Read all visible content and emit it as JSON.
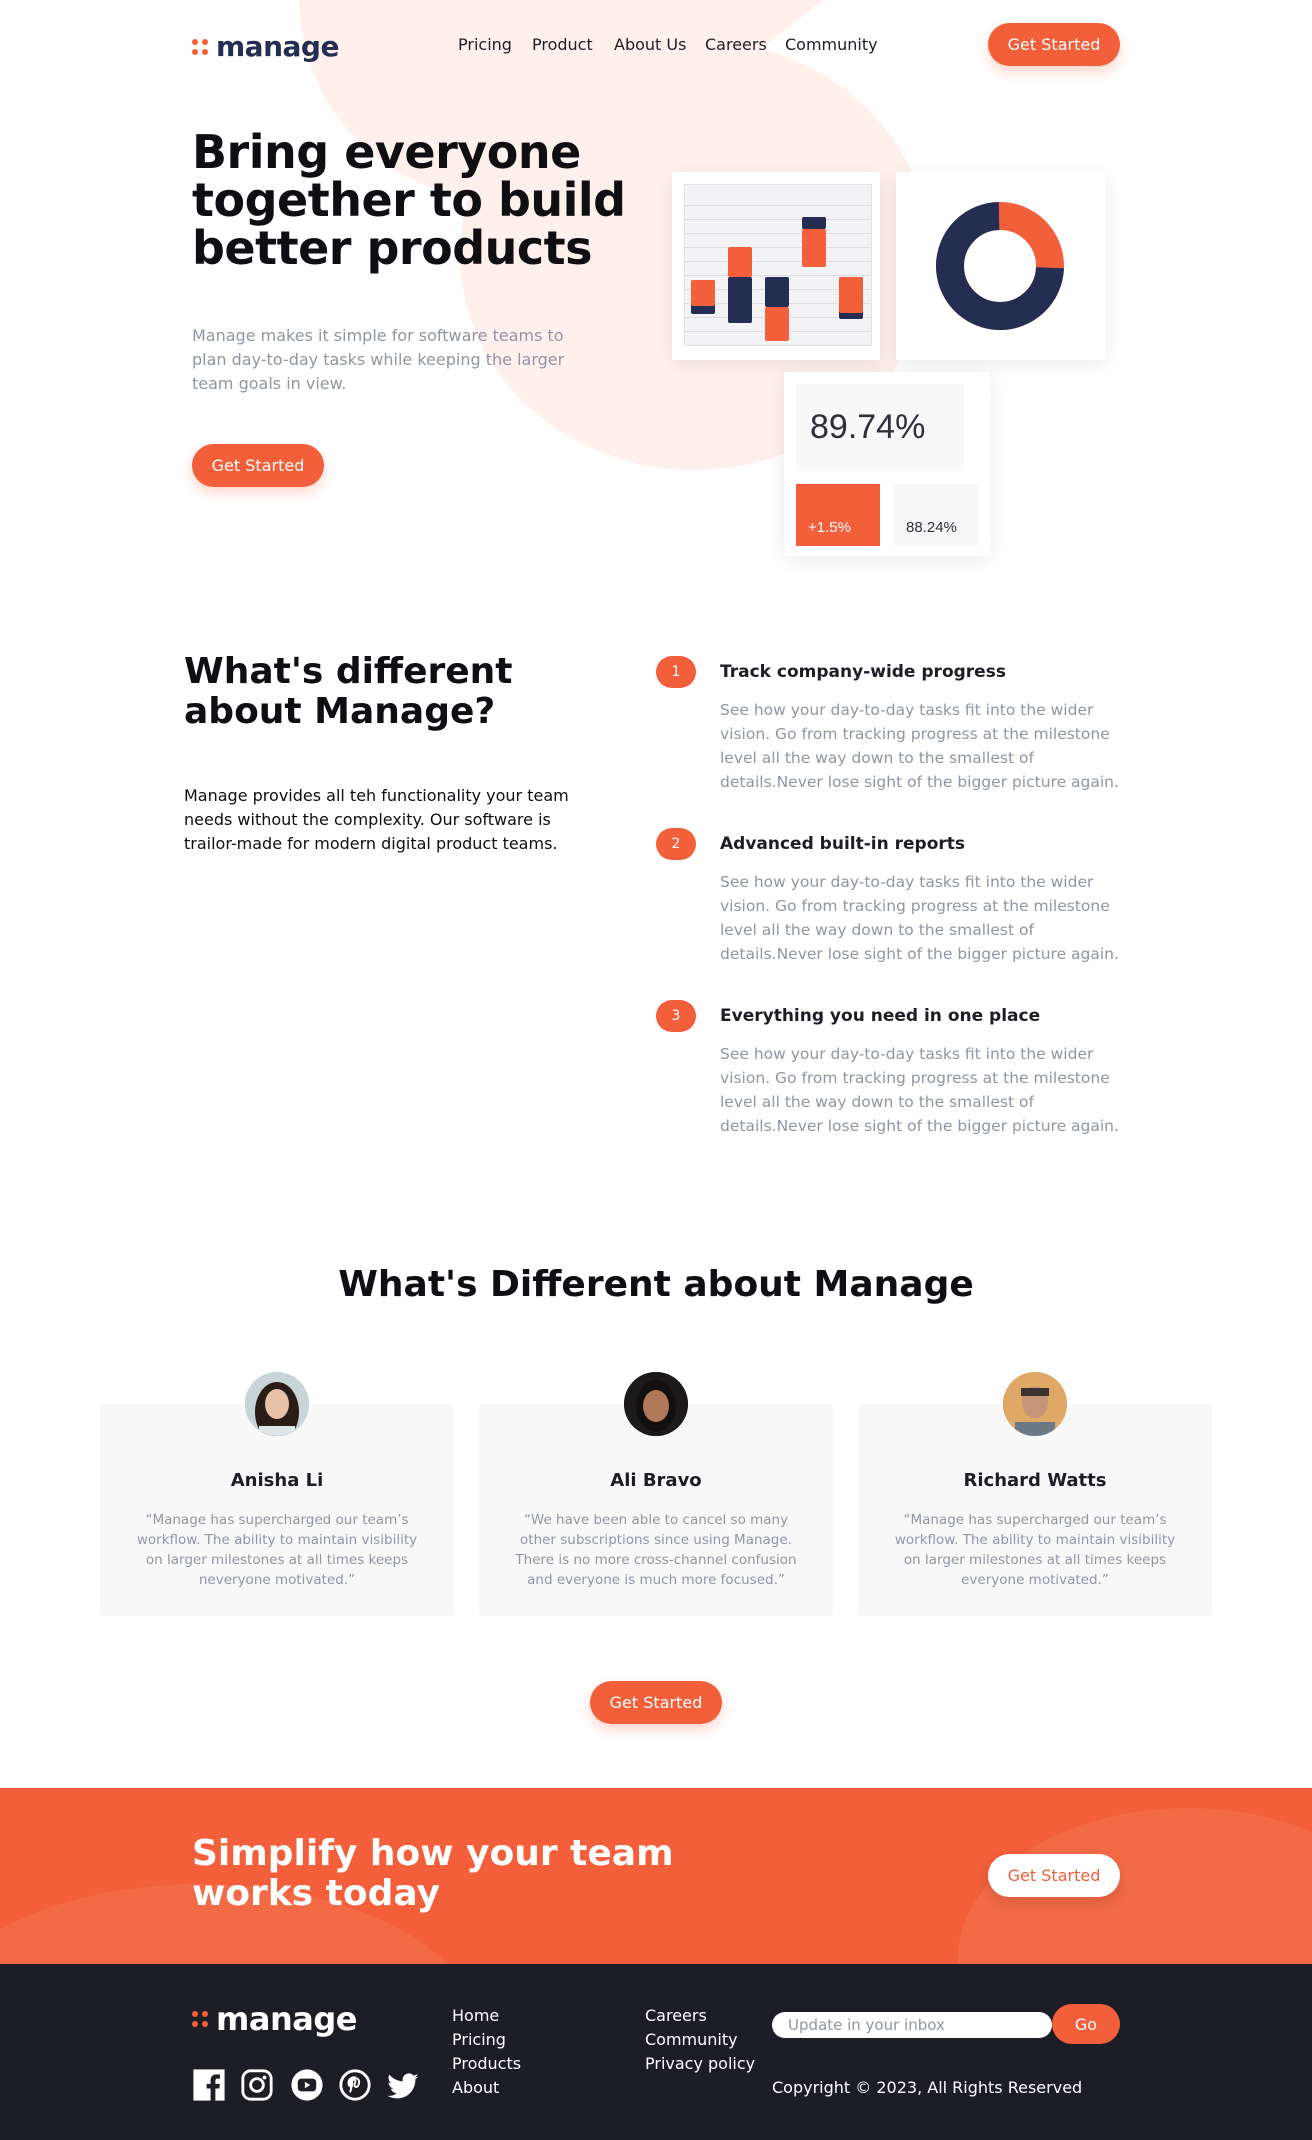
{
  "brand": {
    "name": "manage",
    "accent": "#f25f3a",
    "dark": "#242d52"
  },
  "nav": {
    "items": [
      "Pricing",
      "Product",
      "About Us",
      "Careers",
      "Community"
    ],
    "cta_label": "Get Started"
  },
  "hero": {
    "title": "Bring everyone together to build better products",
    "subtitle": "Manage makes it simple for software teams to plan day-to-day tasks while keeping the larger team goals in view.",
    "cta_label": "Get Started"
  },
  "dashboard": {
    "metric_value": "89.74%",
    "delta_value": "+1.5%",
    "secondary_value": "88.24%",
    "donut_fraction_dark": 0.74
  },
  "different": {
    "title": "What's different about Manage?",
    "subtitle": "Manage provides all teh functionality your team needs without the complexity. Our software is trailor-made for modern digital product teams.",
    "features": [
      {
        "num": "1",
        "title": "Track company-wide progress",
        "desc": "See how your day-to-day tasks fit into the wider vision. Go from tracking progress at the milestone level all the way down to the smallest of details.Never lose sight of the bigger picture again."
      },
      {
        "num": "2",
        "title": "Advanced built-in reports",
        "desc": "See how your day-to-day tasks fit into the wider vision. Go from tracking progress at the milestone level all the way down to the smallest of details.Never lose sight of the bigger picture again."
      },
      {
        "num": "3",
        "title": "Everything you need in one place",
        "desc": "See how your day-to-day tasks fit into the wider vision. Go from tracking progress at the milestone level all the way down to the smallest of details.Never lose sight of the bigger picture again."
      }
    ]
  },
  "testimonials": {
    "title": "What's Different about Manage",
    "items": [
      {
        "name": "Anisha Li",
        "quote": "“Manage has supercharged our team’s workflow. The ability to maintain visibility on larger milestones at all times keeps neveryone motivated.”"
      },
      {
        "name": "Ali Bravo",
        "quote": "“We have been able to cancel so many other subscriptions since using Manage. There is no more cross-channel confusion and everyone is much more focused.”"
      },
      {
        "name": "Richard Watts",
        "quote": "“Manage has supercharged our team’s workflow. The ability to maintain visibility on larger milestones at all times keeps everyone motivated.”"
      }
    ],
    "cta_label": "Get Started"
  },
  "cta_band": {
    "title": "Simplify how your team works today",
    "cta_label": "Get Started"
  },
  "footer": {
    "col1": [
      "Home",
      "Pricing",
      "Products",
      "About"
    ],
    "col2": [
      "Careers",
      "Community",
      "Privacy policy"
    ],
    "newsletter_placeholder": "Update in your inbox",
    "go_label": "Go",
    "copyright": "Copyright © 2023, All Rights Reserved",
    "social": [
      "facebook-icon",
      "instagram-icon",
      "youtube-icon",
      "pinterest-icon",
      "twitter-icon"
    ]
  }
}
